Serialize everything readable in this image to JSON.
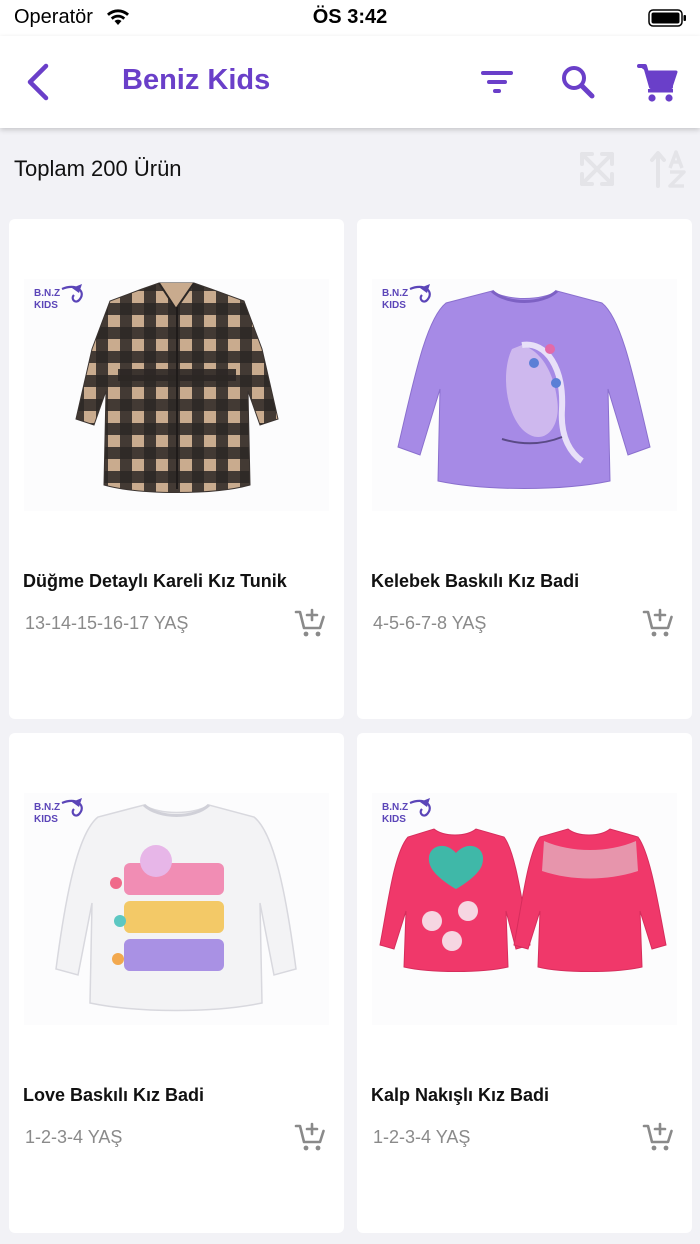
{
  "status": {
    "carrier": "Operatör",
    "time": "ÖS 3:42"
  },
  "nav": {
    "title": "Beniz Kids",
    "icons": [
      "back-chevron-icon",
      "filter-icon",
      "search-icon",
      "cart-icon"
    ],
    "accent_color": "#6a3fc9"
  },
  "listing": {
    "total_label": "Toplam 200 Ürün",
    "tool_icons": [
      "shuffle-icon",
      "sort-az-icon"
    ]
  },
  "brand": {
    "logo_line1": "B.N.Z",
    "logo_line2": "KIDS"
  },
  "products": [
    {
      "title": "Düğme Detaylı Kareli Kız Tunik",
      "sizes": "13-14-15-16-17 YAŞ",
      "color": "#c7a98c",
      "icon": "add-to-cart-icon"
    },
    {
      "title": "Kelebek Baskılı Kız Badi",
      "sizes": "4-5-6-7-8 YAŞ",
      "color": "#a68ae6",
      "icon": "add-to-cart-icon"
    },
    {
      "title": "Love Baskılı Kız Badi",
      "sizes": "1-2-3-4 YAŞ",
      "color": "#f3f3f5",
      "icon": "add-to-cart-icon"
    },
    {
      "title": "Kalp Nakışlı Kız Badi",
      "sizes": "1-2-3-4 YAŞ",
      "color": "#f0386a",
      "icon": "add-to-cart-icon"
    }
  ]
}
